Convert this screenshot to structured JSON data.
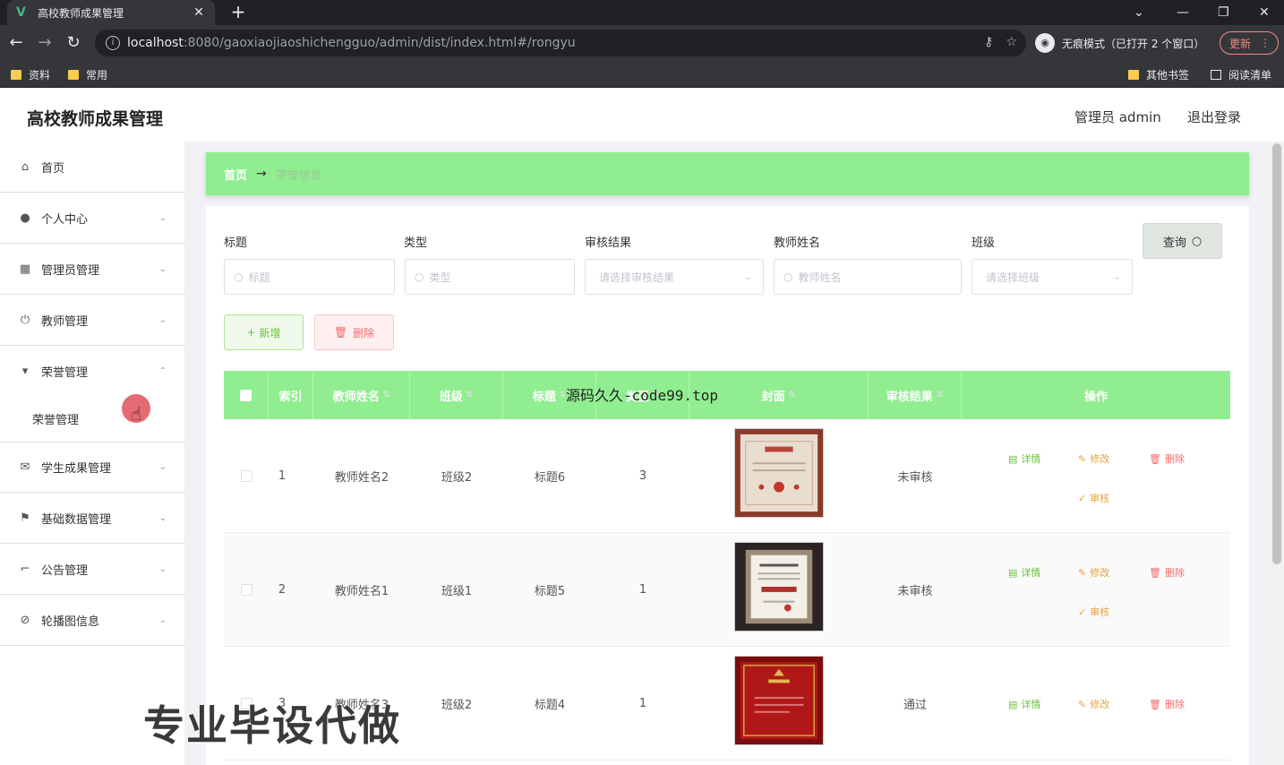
{
  "browser": {
    "tab_title": "高校教师成果管理",
    "url_host": "localhost",
    "url_path": ":8080/gaoxiaojiaoshichengguo/admin/dist/index.html#/rongyu",
    "incognito_label": "无痕模式（已打开 2 个窗口）",
    "update_label": "更新",
    "bookmarks": [
      "资料",
      "常用"
    ],
    "bookmarks_right": [
      "其他书签",
      "阅读清单"
    ]
  },
  "header": {
    "title": "高校教师成果管理",
    "user": "管理员 admin",
    "logout": "退出登录"
  },
  "sidebar": {
    "items": [
      {
        "label": "首页",
        "icon": "home-icon"
      },
      {
        "label": "个人中心",
        "icon": "user-icon"
      },
      {
        "label": "管理员管理",
        "icon": "grid-icon"
      },
      {
        "label": "教师管理",
        "icon": "power-icon"
      },
      {
        "label": "荣誉管理",
        "icon": "cup-icon"
      },
      {
        "label": "学生成果管理",
        "icon": "mail-icon"
      },
      {
        "label": "基础数据管理",
        "icon": "flag-icon"
      },
      {
        "label": "公告管理",
        "icon": "crop-icon"
      },
      {
        "label": "轮播图信息",
        "icon": "image-icon"
      }
    ],
    "sub_item": "荣誉管理"
  },
  "breadcrumb": {
    "home": "首页",
    "current": "荣誉信息"
  },
  "filters": {
    "title_label": "标题",
    "title_placeholder": "标题",
    "type_label": "类型",
    "type_placeholder": "类型",
    "audit_label": "审核结果",
    "audit_placeholder": "请选择审核结果",
    "teacher_label": "教师姓名",
    "teacher_placeholder": "教师姓名",
    "class_label": "班级",
    "class_placeholder": "请选择班级",
    "query_button": "查询"
  },
  "actions": {
    "add": "新增",
    "delete": "删除"
  },
  "table": {
    "columns": [
      "索引",
      "教师姓名",
      "班级",
      "标题",
      "类型",
      "封面",
      "审核结果",
      "操作"
    ],
    "rows": [
      {
        "index": "1",
        "teacher": "教师姓名2",
        "class": "班级2",
        "title": "标题6",
        "type": "3",
        "audit": "未审核"
      },
      {
        "index": "2",
        "teacher": "教师姓名1",
        "class": "班级1",
        "title": "标题5",
        "type": "1",
        "audit": "未审核"
      },
      {
        "index": "3",
        "teacher": "教师姓名3",
        "class": "班级2",
        "title": "标题4",
        "type": "1",
        "audit": "通过"
      }
    ],
    "ops": {
      "detail": "详情",
      "edit": "修改",
      "delete": "删除",
      "audit": "审核"
    }
  },
  "overlay": {
    "source_text": "源码久久-code99.top",
    "promo_text": "专业毕设代做"
  },
  "colors": {
    "accent": "#90ee90",
    "success": "#67c23a",
    "warning": "#e6a23c",
    "danger": "#f56c6c"
  }
}
